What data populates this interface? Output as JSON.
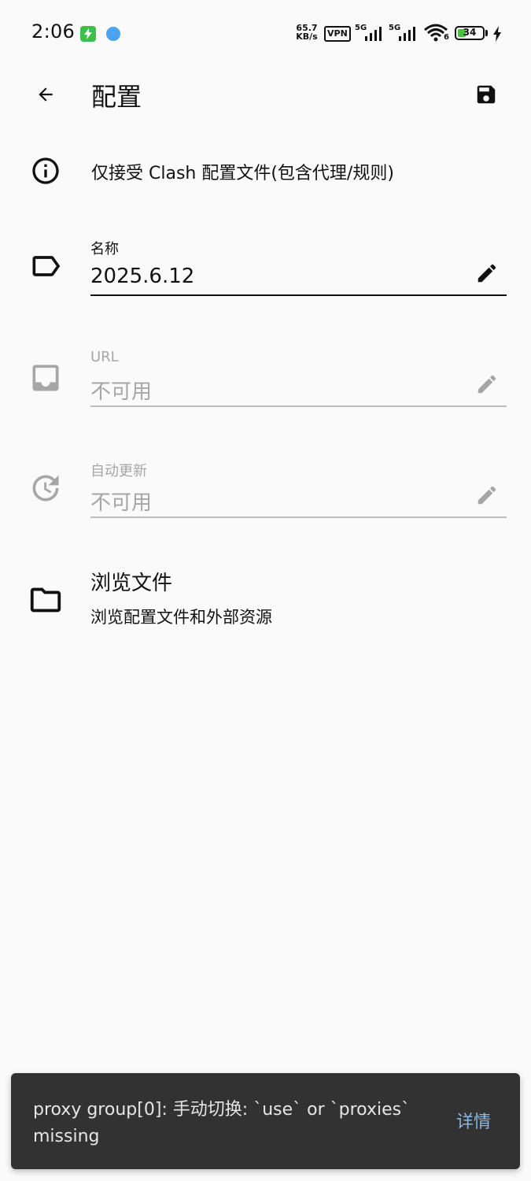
{
  "status_bar": {
    "time": "2:06",
    "net_speed_value": "65.7",
    "net_speed_unit": "KB/s",
    "vpn": "VPN",
    "signal1_label": "5G",
    "signal2_label": "5G",
    "wifi_label": "6",
    "battery": "34",
    "battery_level": 0.34
  },
  "app_bar": {
    "title": "配置"
  },
  "info": {
    "text": "仅接受 Clash 配置文件(包含代理/规则)"
  },
  "fields": {
    "name": {
      "label": "名称",
      "value": "2025.6.12"
    },
    "url": {
      "label": "URL",
      "value": "不可用"
    },
    "auto_update": {
      "label": "自动更新",
      "value": "不可用"
    }
  },
  "browse": {
    "title": "浏览文件",
    "subtitle": "浏览配置文件和外部资源"
  },
  "snackbar": {
    "message": "proxy group[0]: 手动切换: `use` or `proxies` missing",
    "action": "详情"
  },
  "colors": {
    "background": "#fafafa",
    "text": "#111111",
    "disabled": "#a6a6a6",
    "snackbar_bg": "#323232",
    "snackbar_action": "#8fb6de",
    "battery_fill": "#48c040"
  }
}
